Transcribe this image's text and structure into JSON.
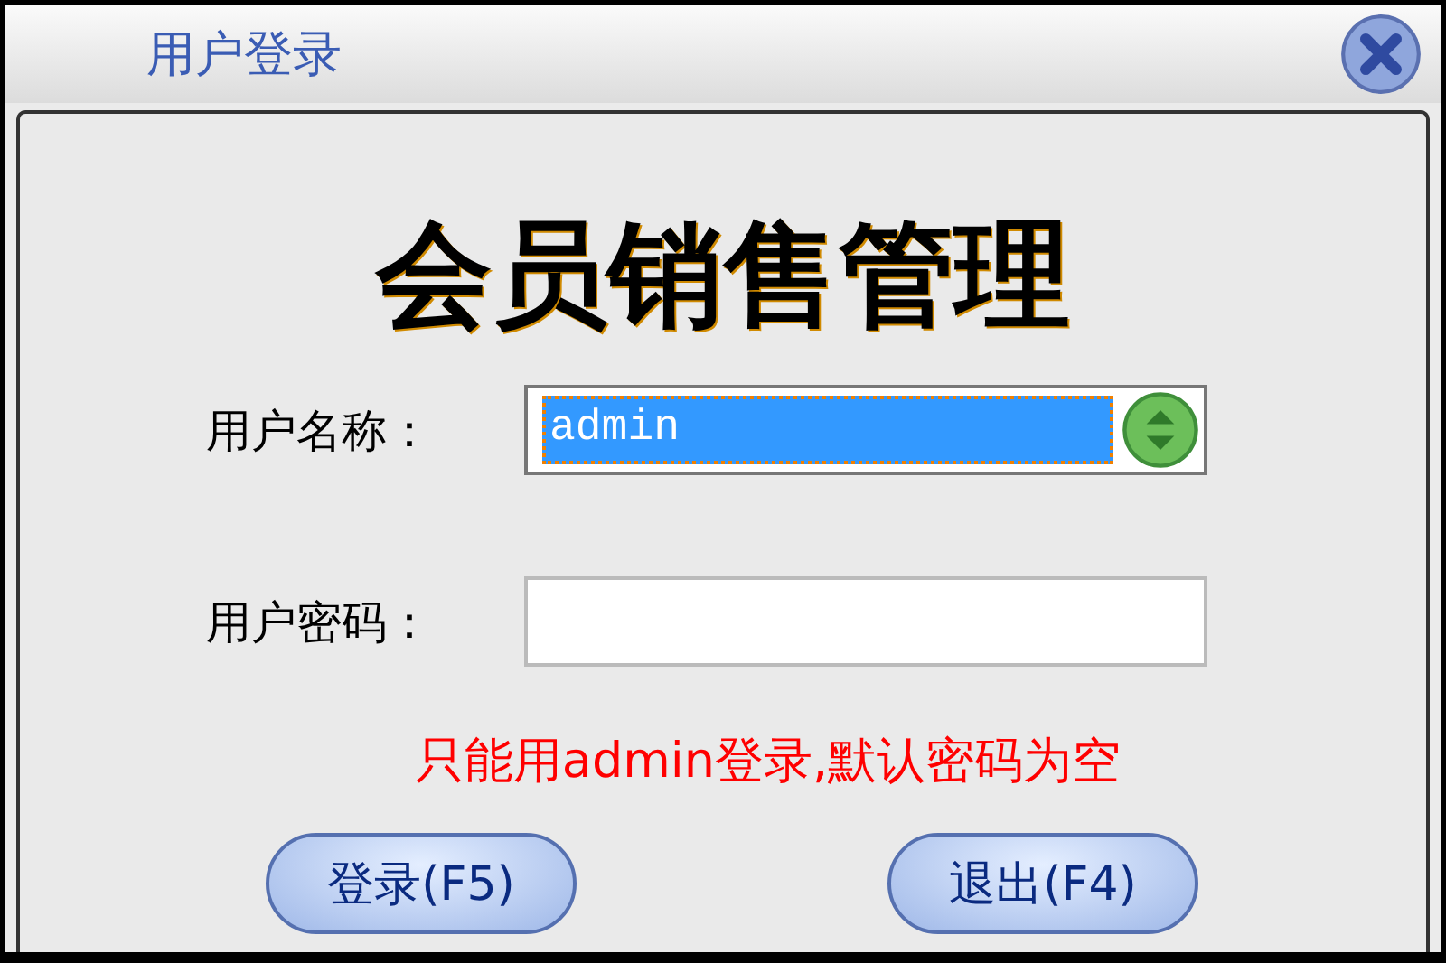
{
  "window": {
    "title": "用户登录"
  },
  "heading": "会员销售管理",
  "fields": [
    {
      "kind": "combo",
      "label": "用户名称：",
      "value": "admin",
      "selected": true
    },
    {
      "kind": "password",
      "label": "用户密码："
    }
  ],
  "note": "只能用admin登录,默认密码为空",
  "buttons": [
    "登录(F5)",
    "退出(F4)"
  ]
}
